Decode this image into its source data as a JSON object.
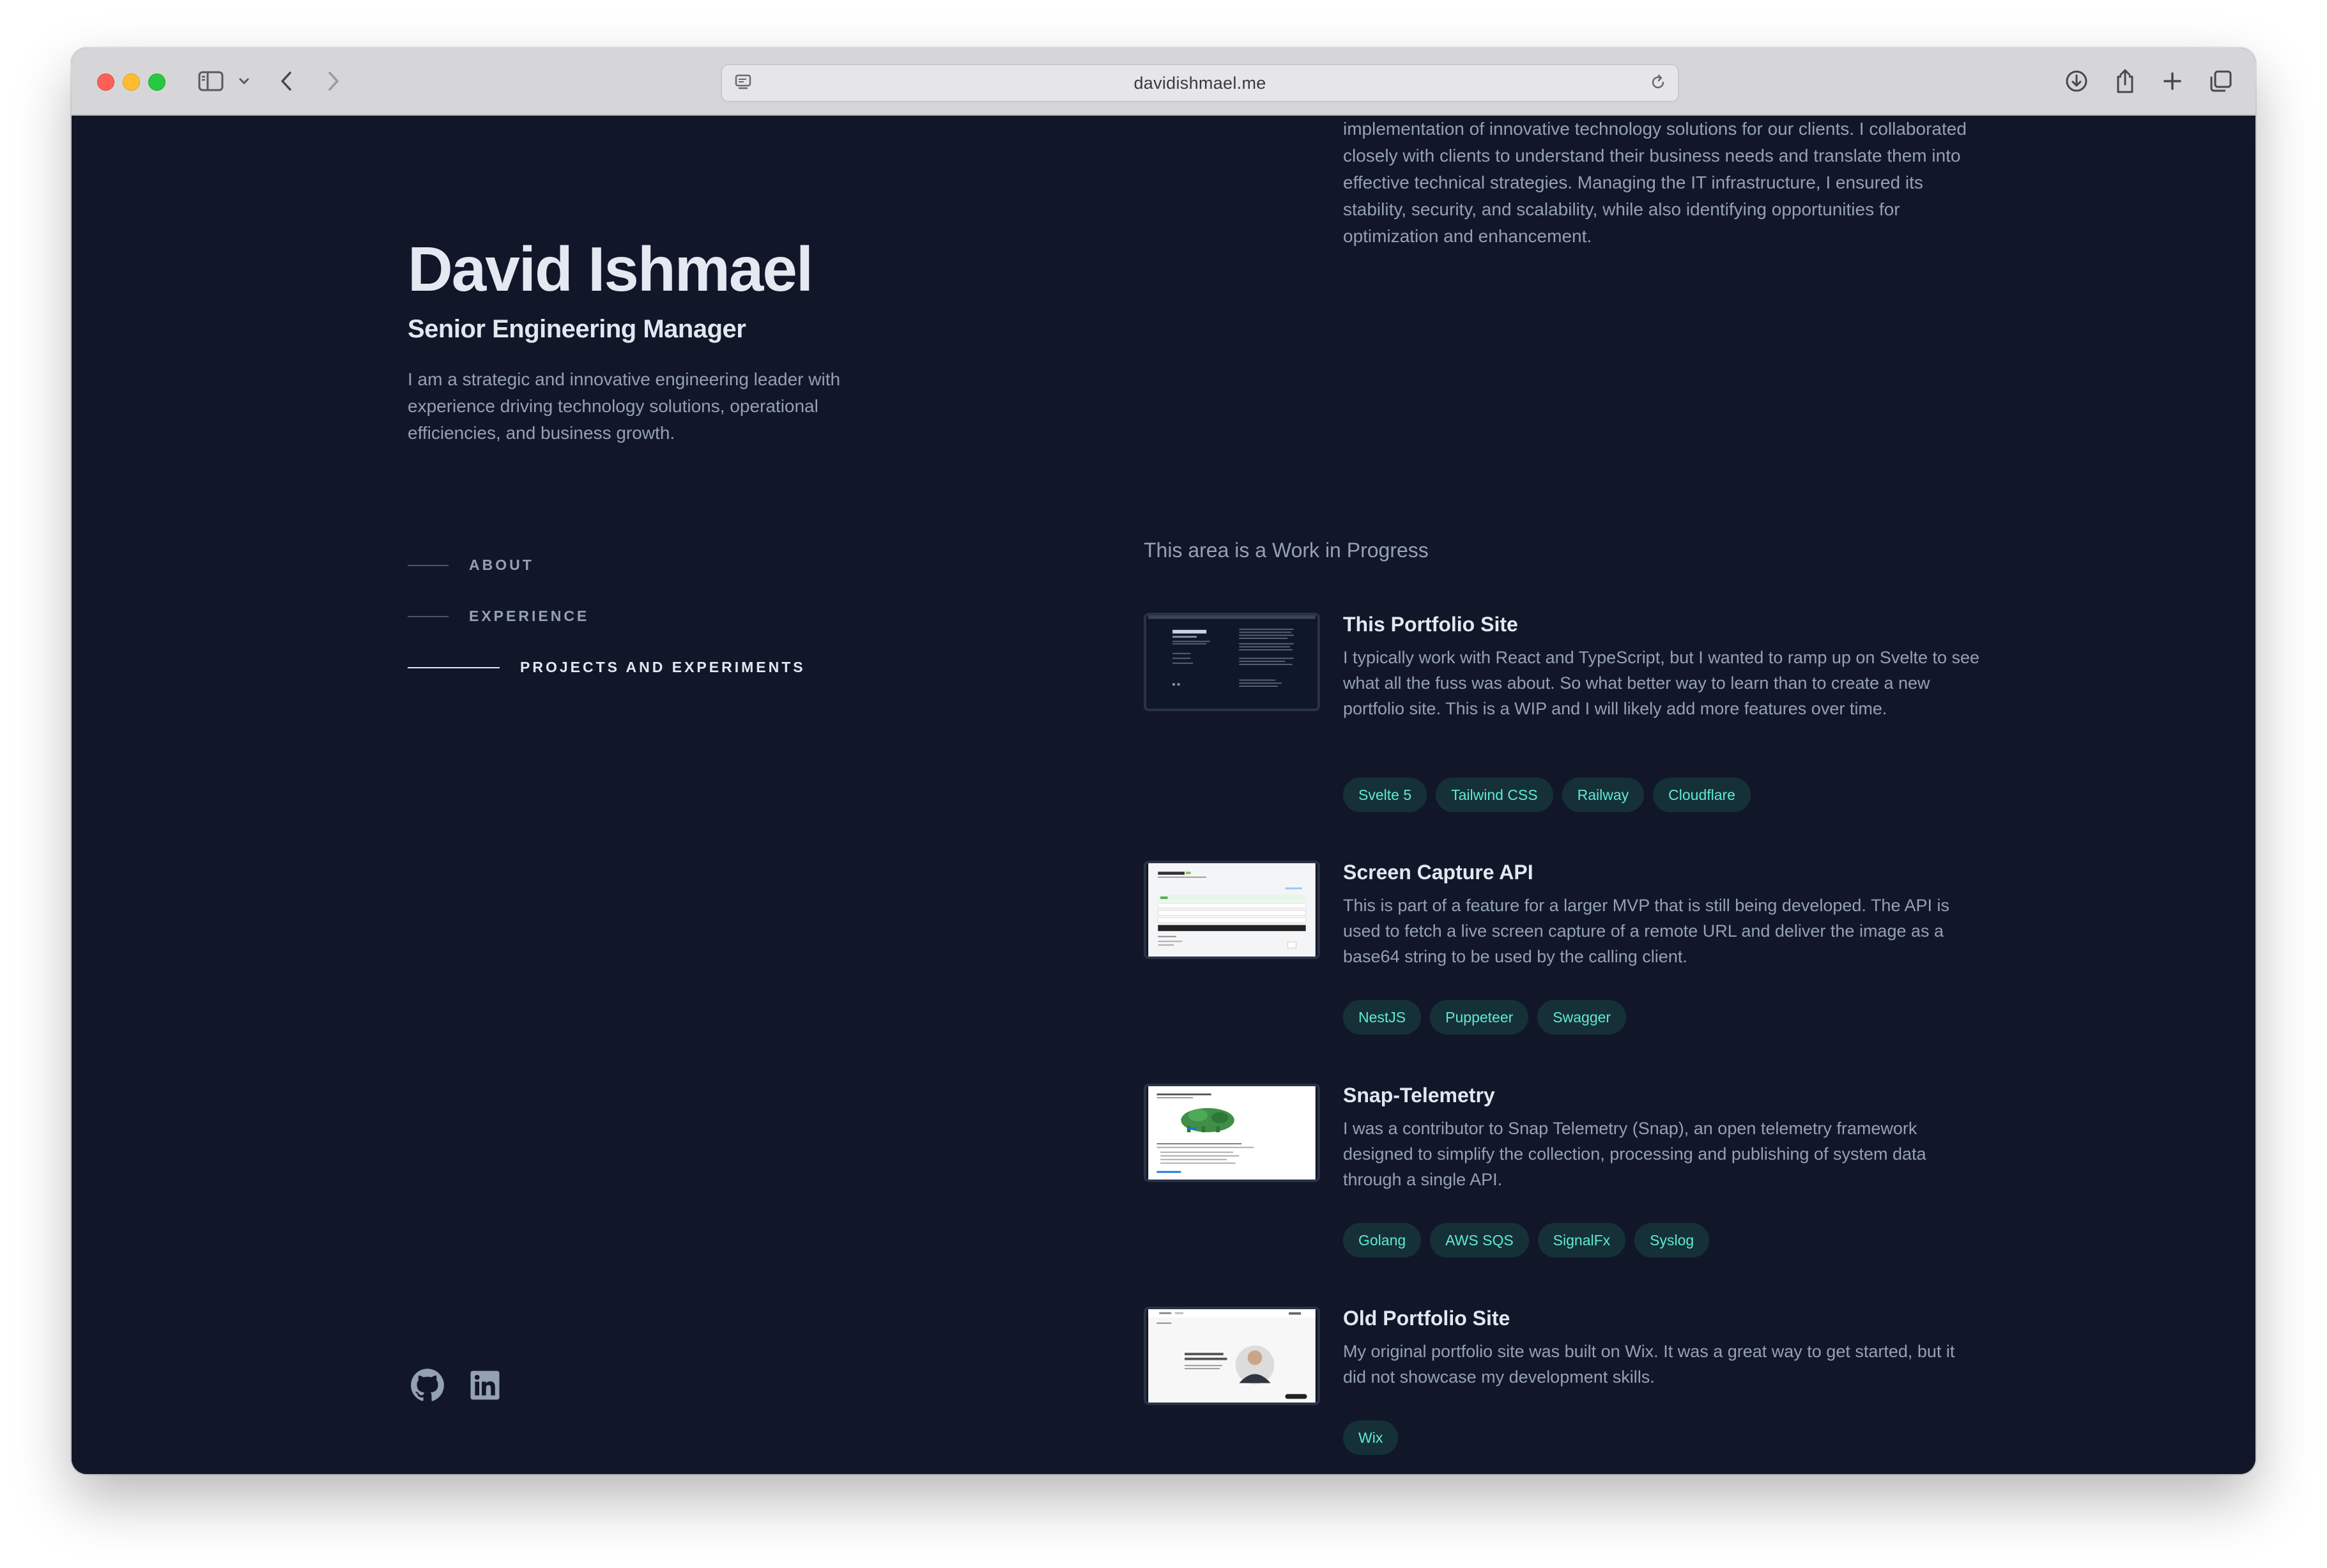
{
  "browser": {
    "url": "davidishmael.me"
  },
  "profile": {
    "name": "David Ishmael",
    "role": "Senior Engineering Manager",
    "intro": "I am a strategic and innovative engineering leader with experience driving technology solutions, operational efficiencies, and business growth."
  },
  "nav": {
    "items": [
      {
        "label": "ABOUT",
        "active": false
      },
      {
        "label": "EXPERIENCE",
        "active": false
      },
      {
        "label": "PROJECTS AND EXPERIMENTS",
        "active": true
      }
    ]
  },
  "socials": {
    "icons": [
      "github-icon",
      "linkedin-icon"
    ]
  },
  "experience": {
    "partial_text": "engineers, analysts, and technicians, I oversaw the design, development, and implementation of innovative technology solutions for our clients. I collaborated closely with clients to understand their business needs and translate them into effective technical strategies. Managing the IT infrastructure, I ensured its stability, security, and scalability, while also identifying opportunities for optimization and enhancement."
  },
  "projects": {
    "wip_note": "This area is a Work in Progress",
    "items": [
      {
        "title": "This Portfolio Site",
        "description": "I typically work with React and TypeScript, but I wanted to ramp up on Svelte to see what all the fuss was about. So what better way to learn than to create a new portfolio site. This is a WIP and I will likely add more features over time.",
        "tags": [
          "Svelte 5",
          "Tailwind CSS",
          "Railway",
          "Cloudflare"
        ]
      },
      {
        "title": "Screen Capture API",
        "description": "This is part of a feature for a larger MVP that is still being developed. The API is used to fetch a live screen capture of a remote URL and deliver the image as a base64 string to be used by the calling client.",
        "tags": [
          "NestJS",
          "Puppeteer",
          "Swagger"
        ]
      },
      {
        "title": "Snap-Telemetry",
        "description": "I was a contributor to Snap Telemetry (Snap), an open telemetry framework designed to simplify the collection, processing and publishing of system data through a single API.",
        "tags": [
          "Golang",
          "AWS SQS",
          "SignalFx",
          "Syslog"
        ]
      },
      {
        "title": "Old Portfolio Site",
        "description": "My original portfolio site was built on Wix. It was a great way to get started, but it did not showcase my development skills.",
        "tags": [
          "Wix"
        ]
      }
    ]
  },
  "colors": {
    "background": "#111729",
    "text_primary": "#e2e8f0",
    "text_muted": "#94a1b4",
    "tag_background": "#163038",
    "tag_text": "#5eead4"
  }
}
